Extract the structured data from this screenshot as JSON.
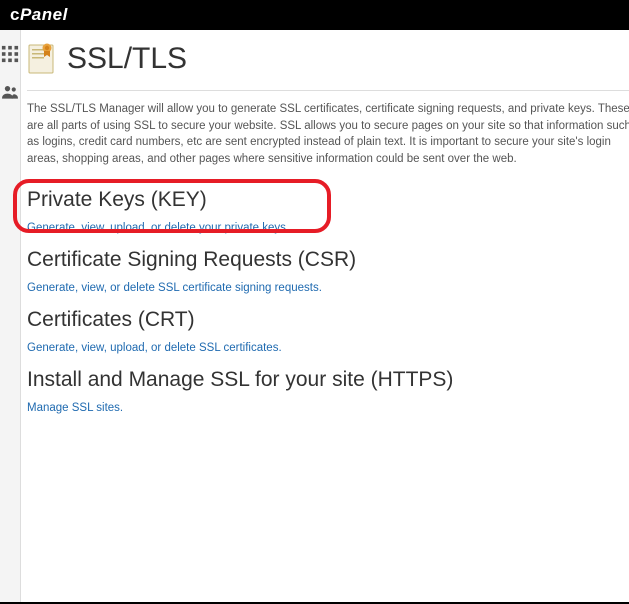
{
  "brand": "cPanel",
  "page": {
    "title": "SSL/TLS",
    "intro": "The SSL/TLS Manager will allow you to generate SSL certificates, certificate signing requests, and private keys. These are all parts of using SSL to secure your website. SSL allows you to secure pages on your site so that information such as logins, credit card numbers, etc are sent encrypted instead of plain text. It is important to secure your site's login areas, shopping areas, and other pages where sensitive information could be sent over the web."
  },
  "sections": [
    {
      "title": "Private Keys (KEY)",
      "link": "Generate, view, upload, or delete your private keys."
    },
    {
      "title": "Certificate Signing Requests (CSR)",
      "link": "Generate, view, or delete SSL certificate signing requests."
    },
    {
      "title": "Certificates (CRT)",
      "link": "Generate, view, upload, or delete SSL certificates."
    },
    {
      "title": "Install and Manage SSL for your site (HTTPS)",
      "link": "Manage SSL sites."
    }
  ]
}
